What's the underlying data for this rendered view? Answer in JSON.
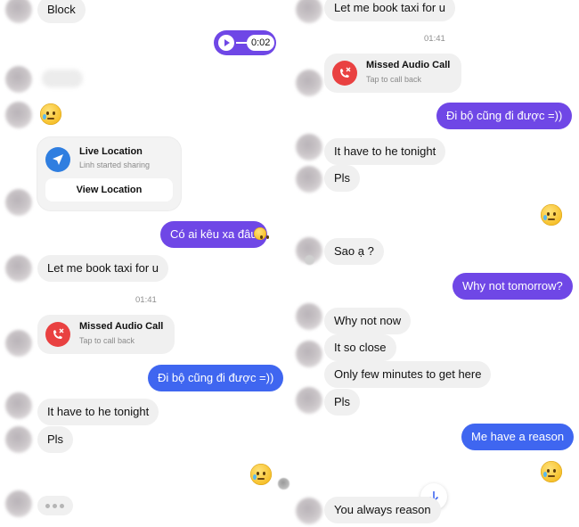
{
  "left": {
    "block_label": "Block",
    "voice_duration": "0:02",
    "location": {
      "title": "Live Location",
      "subtitle": "Linh started sharing",
      "button": "View Location"
    },
    "msg_co_ai": "Có ai kêu xa đâu",
    "msg_taxi": "Let me book taxi for u",
    "time": "01:41",
    "missed_call": {
      "title": "Missed Audio Call",
      "subtitle": "Tap to call back"
    },
    "msg_di_bo": "Đi bộ cũng đi được =))",
    "msg_have_to": "It have to he tonight",
    "msg_pls": "Pls"
  },
  "right": {
    "msg_taxi": "Let me book taxi for u",
    "time": "01:41",
    "missed_call": {
      "title": "Missed Audio Call",
      "subtitle": "Tap to call back"
    },
    "msg_di_bo": "Đi bộ cũng đi được =))",
    "msg_have_to": "It have to he tonight",
    "msg_pls": "Pls",
    "msg_sao": "Sao ạ ?",
    "msg_why_tomorrow": "Why not tomorrow?",
    "msg_why_now": "Why not now",
    "msg_so_close": "It so close",
    "msg_few_minutes": "Only few minutes to get here",
    "msg_pls2": "Pls",
    "msg_reason": "Me have a reason",
    "msg_always": "You always reason"
  },
  "colors": {
    "outgoing_purple": "#6f47e6",
    "outgoing_blue": "#3f66f0",
    "incoming_bg": "#f0f0f0",
    "missed_call_red": "#e94141",
    "location_blue": "#2f7ee0"
  },
  "icons": [
    "play-icon",
    "location-arrow-icon",
    "missed-call-icon",
    "crying-face-emoji",
    "arrow-down-icon",
    "typing-dots"
  ]
}
